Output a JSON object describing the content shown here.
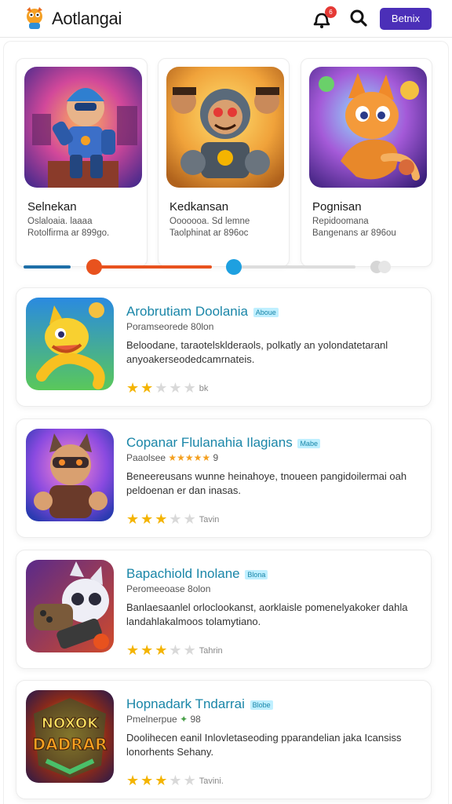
{
  "header": {
    "title": "Aotlangai",
    "notification_count": "6",
    "action_button": "Betnix",
    "icons": {
      "logo": "mascot-logo-icon",
      "notifications": "bell-icon",
      "search": "search-icon"
    }
  },
  "carousel": [
    {
      "title": "Selnekan",
      "line1": "Oslaloaia. laaaa",
      "line2": "Rotolfirma ar 899go.",
      "art": "robot-hero-art"
    },
    {
      "title": "Kedkansan",
      "line1": "Ooooooa. Sd lemne",
      "line2": "Taolphinat ar 896oc",
      "art": "cyborg-brawler-art"
    },
    {
      "title": "Pognisan",
      "line1": "Repidoomana",
      "line2": "Bangenans ar 896ou",
      "art": "fox-creature-art"
    }
  ],
  "carousel_progress": [
    {
      "track_color": "#1e6fa8",
      "value": 0.25
    },
    {
      "track_color": "#e8521e",
      "value": 0.55
    },
    {
      "track_color": "#dddddd",
      "value": 0.0
    }
  ],
  "list": [
    {
      "title": "Arobrutiam Doolania",
      "tag": "Aboue",
      "meta": "Poramseorede 80lon",
      "desc": "Beloodane, taraotelsklderaols, polkatly an yolondatetaranl anyoakerseodedcamrnateis.",
      "stars": 2,
      "rating": "bk",
      "art": "yellow-dragon-art"
    },
    {
      "title": "Copanar Flulanahia Ilagians",
      "tag": "Mabe",
      "meta": "Paaolsee",
      "meta_stars": "★★★★★",
      "meta_count": "9",
      "desc": "Beneereusans wunne heinahoye, tnoueen pangidoilermai oah peldoenan er dan inasas.",
      "stars": 3,
      "rating": "Tavin",
      "art": "masked-warrior-art"
    },
    {
      "title": "Bapachiold Inolane",
      "tag": "Blona",
      "meta": "Peromeeoase 8olon",
      "desc": "Banlaesaanlel orloclookanst, aorklaisle pomenelyakoker dahla landahlakalmoos tolamytiano.",
      "stars": 3,
      "rating": "Tahrin",
      "art": "panda-gamer-art"
    },
    {
      "title": "Hopnadark Tndarrai",
      "tag": "Blobe",
      "meta": "Pmelnerpue",
      "meta_icon": "✦",
      "meta_count": "98",
      "desc": "Doolihecen eanil Inlovletaseoding pparandelian jaka Icansiss lonorhents Sehany.",
      "stars": 3,
      "rating": "Tavini.",
      "art": "dragon-logo-art",
      "art_text": "NOXOK DADRAR"
    }
  ],
  "colors": {
    "accent": "#4b2fb8",
    "title_teal": "#1a86a8",
    "star": "#f4b400",
    "badge_red": "#e53935"
  }
}
